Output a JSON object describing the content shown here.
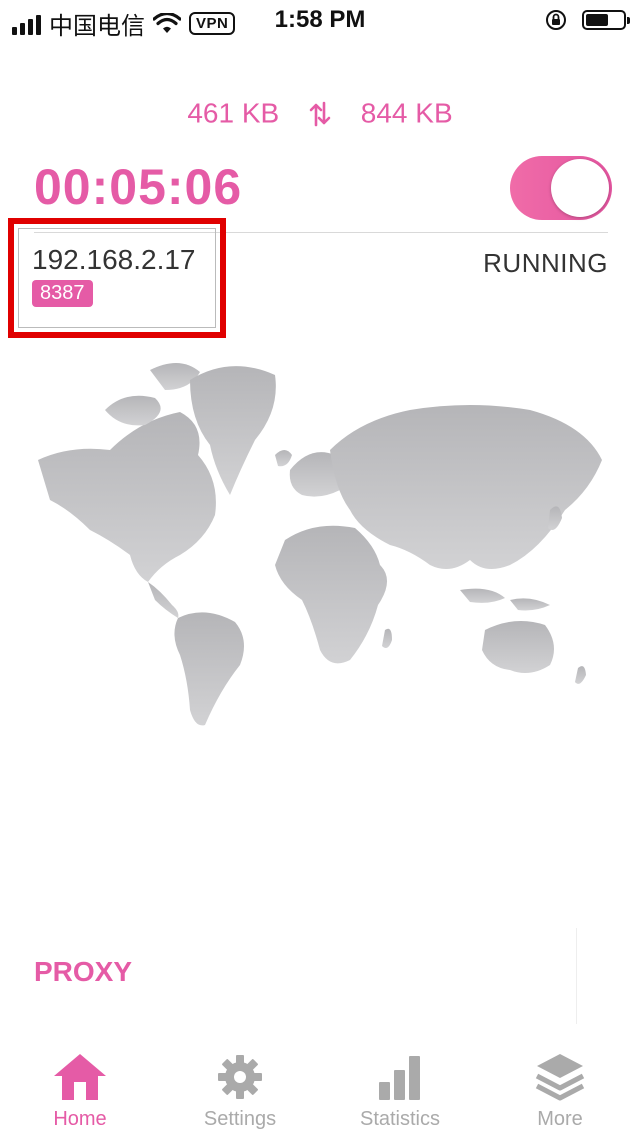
{
  "status_bar": {
    "carrier": "中国电信",
    "vpn": "VPN",
    "time": "1:58 PM",
    "battery_level": 0.6
  },
  "traffic": {
    "download": "461 KB",
    "upload": "844 KB"
  },
  "connection": {
    "timer": "00:05:06",
    "toggle_on": true,
    "ip": "192.168.2.17",
    "port": "8387",
    "status": "RUNNING"
  },
  "proxy": {
    "label": "PROXY"
  },
  "tabs": [
    {
      "label": "Home",
      "icon": "home-icon",
      "active": true
    },
    {
      "label": "Settings",
      "icon": "gear-icon",
      "active": false
    },
    {
      "label": "Statistics",
      "icon": "bar-chart-icon",
      "active": false
    },
    {
      "label": "More",
      "icon": "layers-icon",
      "active": false
    }
  ],
  "colors": {
    "accent": "#e55ba6",
    "inactive": "#aaaaaa",
    "highlight_box": "#e00000",
    "map": "#a9a9ad"
  }
}
